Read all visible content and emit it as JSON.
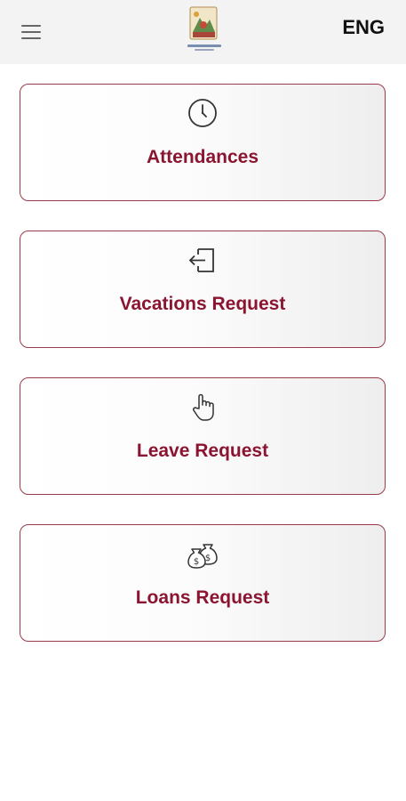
{
  "header": {
    "menu_icon": "hamburger-menu-icon",
    "logo": "company-logo",
    "language_label": "ENG"
  },
  "cards": [
    {
      "label": "Attendances",
      "icon": "clock-icon"
    },
    {
      "label": "Vacations Request",
      "icon": "exit-door-icon"
    },
    {
      "label": "Leave Request",
      "icon": "hand-pointer-icon"
    },
    {
      "label": "Loans Request",
      "icon": "money-bags-icon"
    }
  ],
  "colors": {
    "accent": "#8b1530",
    "card_border": "#9a3b4a",
    "header_bg": "#f3f3f3"
  }
}
